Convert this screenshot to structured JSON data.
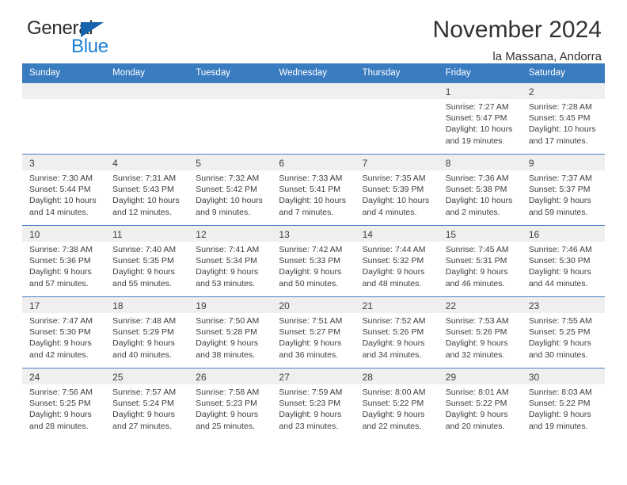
{
  "brand": {
    "name_top": "General",
    "name_bottom": "Blue",
    "accent_blue": "#1b7fd4",
    "triangle_blue": "#1763ab"
  },
  "header": {
    "title": "November 2024",
    "subtitle": "la Massana, Andorra"
  },
  "colors": {
    "header_row_bg": "#3a7cc0",
    "daynum_bg": "#efefef",
    "cell_border": "#4a83c2",
    "text": "#3d3d3d"
  },
  "weekday_headers": [
    "Sunday",
    "Monday",
    "Tuesday",
    "Wednesday",
    "Thursday",
    "Friday",
    "Saturday"
  ],
  "labels": {
    "sunrise": "Sunrise:",
    "sunset": "Sunset:",
    "daylight": "Daylight:"
  },
  "weeks": [
    [
      {
        "day": "",
        "empty": true
      },
      {
        "day": "",
        "empty": true
      },
      {
        "day": "",
        "empty": true
      },
      {
        "day": "",
        "empty": true
      },
      {
        "day": "",
        "empty": true
      },
      {
        "day": "1",
        "sunrise": "Sunrise: 7:27 AM",
        "sunset": "Sunset: 5:47 PM",
        "daylight": "Daylight: 10 hours and 19 minutes."
      },
      {
        "day": "2",
        "sunrise": "Sunrise: 7:28 AM",
        "sunset": "Sunset: 5:45 PM",
        "daylight": "Daylight: 10 hours and 17 minutes."
      }
    ],
    [
      {
        "day": "3",
        "sunrise": "Sunrise: 7:30 AM",
        "sunset": "Sunset: 5:44 PM",
        "daylight": "Daylight: 10 hours and 14 minutes."
      },
      {
        "day": "4",
        "sunrise": "Sunrise: 7:31 AM",
        "sunset": "Sunset: 5:43 PM",
        "daylight": "Daylight: 10 hours and 12 minutes."
      },
      {
        "day": "5",
        "sunrise": "Sunrise: 7:32 AM",
        "sunset": "Sunset: 5:42 PM",
        "daylight": "Daylight: 10 hours and 9 minutes."
      },
      {
        "day": "6",
        "sunrise": "Sunrise: 7:33 AM",
        "sunset": "Sunset: 5:41 PM",
        "daylight": "Daylight: 10 hours and 7 minutes."
      },
      {
        "day": "7",
        "sunrise": "Sunrise: 7:35 AM",
        "sunset": "Sunset: 5:39 PM",
        "daylight": "Daylight: 10 hours and 4 minutes."
      },
      {
        "day": "8",
        "sunrise": "Sunrise: 7:36 AM",
        "sunset": "Sunset: 5:38 PM",
        "daylight": "Daylight: 10 hours and 2 minutes."
      },
      {
        "day": "9",
        "sunrise": "Sunrise: 7:37 AM",
        "sunset": "Sunset: 5:37 PM",
        "daylight": "Daylight: 9 hours and 59 minutes."
      }
    ],
    [
      {
        "day": "10",
        "sunrise": "Sunrise: 7:38 AM",
        "sunset": "Sunset: 5:36 PM",
        "daylight": "Daylight: 9 hours and 57 minutes."
      },
      {
        "day": "11",
        "sunrise": "Sunrise: 7:40 AM",
        "sunset": "Sunset: 5:35 PM",
        "daylight": "Daylight: 9 hours and 55 minutes."
      },
      {
        "day": "12",
        "sunrise": "Sunrise: 7:41 AM",
        "sunset": "Sunset: 5:34 PM",
        "daylight": "Daylight: 9 hours and 53 minutes."
      },
      {
        "day": "13",
        "sunrise": "Sunrise: 7:42 AM",
        "sunset": "Sunset: 5:33 PM",
        "daylight": "Daylight: 9 hours and 50 minutes."
      },
      {
        "day": "14",
        "sunrise": "Sunrise: 7:44 AM",
        "sunset": "Sunset: 5:32 PM",
        "daylight": "Daylight: 9 hours and 48 minutes."
      },
      {
        "day": "15",
        "sunrise": "Sunrise: 7:45 AM",
        "sunset": "Sunset: 5:31 PM",
        "daylight": "Daylight: 9 hours and 46 minutes."
      },
      {
        "day": "16",
        "sunrise": "Sunrise: 7:46 AM",
        "sunset": "Sunset: 5:30 PM",
        "daylight": "Daylight: 9 hours and 44 minutes."
      }
    ],
    [
      {
        "day": "17",
        "sunrise": "Sunrise: 7:47 AM",
        "sunset": "Sunset: 5:30 PM",
        "daylight": "Daylight: 9 hours and 42 minutes."
      },
      {
        "day": "18",
        "sunrise": "Sunrise: 7:48 AM",
        "sunset": "Sunset: 5:29 PM",
        "daylight": "Daylight: 9 hours and 40 minutes."
      },
      {
        "day": "19",
        "sunrise": "Sunrise: 7:50 AM",
        "sunset": "Sunset: 5:28 PM",
        "daylight": "Daylight: 9 hours and 38 minutes."
      },
      {
        "day": "20",
        "sunrise": "Sunrise: 7:51 AM",
        "sunset": "Sunset: 5:27 PM",
        "daylight": "Daylight: 9 hours and 36 minutes."
      },
      {
        "day": "21",
        "sunrise": "Sunrise: 7:52 AM",
        "sunset": "Sunset: 5:26 PM",
        "daylight": "Daylight: 9 hours and 34 minutes."
      },
      {
        "day": "22",
        "sunrise": "Sunrise: 7:53 AM",
        "sunset": "Sunset: 5:26 PM",
        "daylight": "Daylight: 9 hours and 32 minutes."
      },
      {
        "day": "23",
        "sunrise": "Sunrise: 7:55 AM",
        "sunset": "Sunset: 5:25 PM",
        "daylight": "Daylight: 9 hours and 30 minutes."
      }
    ],
    [
      {
        "day": "24",
        "sunrise": "Sunrise: 7:56 AM",
        "sunset": "Sunset: 5:25 PM",
        "daylight": "Daylight: 9 hours and 28 minutes."
      },
      {
        "day": "25",
        "sunrise": "Sunrise: 7:57 AM",
        "sunset": "Sunset: 5:24 PM",
        "daylight": "Daylight: 9 hours and 27 minutes."
      },
      {
        "day": "26",
        "sunrise": "Sunrise: 7:58 AM",
        "sunset": "Sunset: 5:23 PM",
        "daylight": "Daylight: 9 hours and 25 minutes."
      },
      {
        "day": "27",
        "sunrise": "Sunrise: 7:59 AM",
        "sunset": "Sunset: 5:23 PM",
        "daylight": "Daylight: 9 hours and 23 minutes."
      },
      {
        "day": "28",
        "sunrise": "Sunrise: 8:00 AM",
        "sunset": "Sunset: 5:22 PM",
        "daylight": "Daylight: 9 hours and 22 minutes."
      },
      {
        "day": "29",
        "sunrise": "Sunrise: 8:01 AM",
        "sunset": "Sunset: 5:22 PM",
        "daylight": "Daylight: 9 hours and 20 minutes."
      },
      {
        "day": "30",
        "sunrise": "Sunrise: 8:03 AM",
        "sunset": "Sunset: 5:22 PM",
        "daylight": "Daylight: 9 hours and 19 minutes."
      }
    ]
  ]
}
